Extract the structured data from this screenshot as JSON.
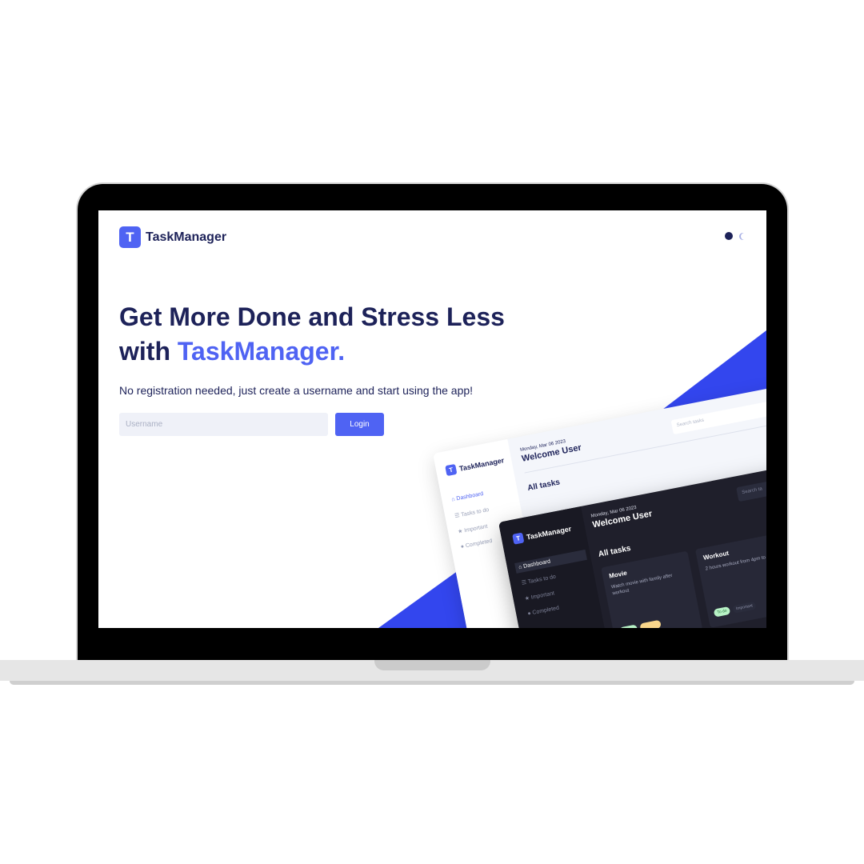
{
  "app": {
    "logo_letter": "T",
    "logo_text": "TaskManager"
  },
  "hero": {
    "headline_line1": "Get More Done and Stress Less",
    "headline_prefix": "with ",
    "headline_accent": "TaskManager.",
    "subtitle": "No registration needed, just create a username and start using the app!"
  },
  "login_form": {
    "username_placeholder": "Username",
    "username_value": "",
    "login_label": "Login"
  },
  "preview_light": {
    "logo_letter": "T",
    "logo_text": "TaskManager",
    "nav": [
      "Dashboard",
      "Tasks to do",
      "Important",
      "Completed"
    ],
    "date": "Monday, Mar 06 2023",
    "welcome": "Welcome User",
    "search_placeholder": "Search tasks",
    "section_title": "All tasks"
  },
  "preview_dark": {
    "logo_letter": "T",
    "logo_text": "TaskManager",
    "nav": [
      "Dashboard",
      "Tasks to do",
      "Important",
      "Completed"
    ],
    "date": "Monday, Mar 06 2023",
    "welcome": "Welcome User",
    "search_placeholder": "Search ta",
    "section_title": "All tasks",
    "cards": [
      {
        "title": "Movie",
        "description": "Watch movie with family after workout"
      },
      {
        "title": "Workout",
        "description": "2 hours workout from 4pm to"
      }
    ],
    "tags": {
      "todo": "To do",
      "important": "Important"
    }
  },
  "colors": {
    "accent": "#4f63f3",
    "navy": "#1d2259",
    "input_bg": "#eff1f8"
  },
  "icons": [
    "home-icon",
    "list-icon",
    "star-icon",
    "check-circle-icon",
    "moon-icon"
  ]
}
